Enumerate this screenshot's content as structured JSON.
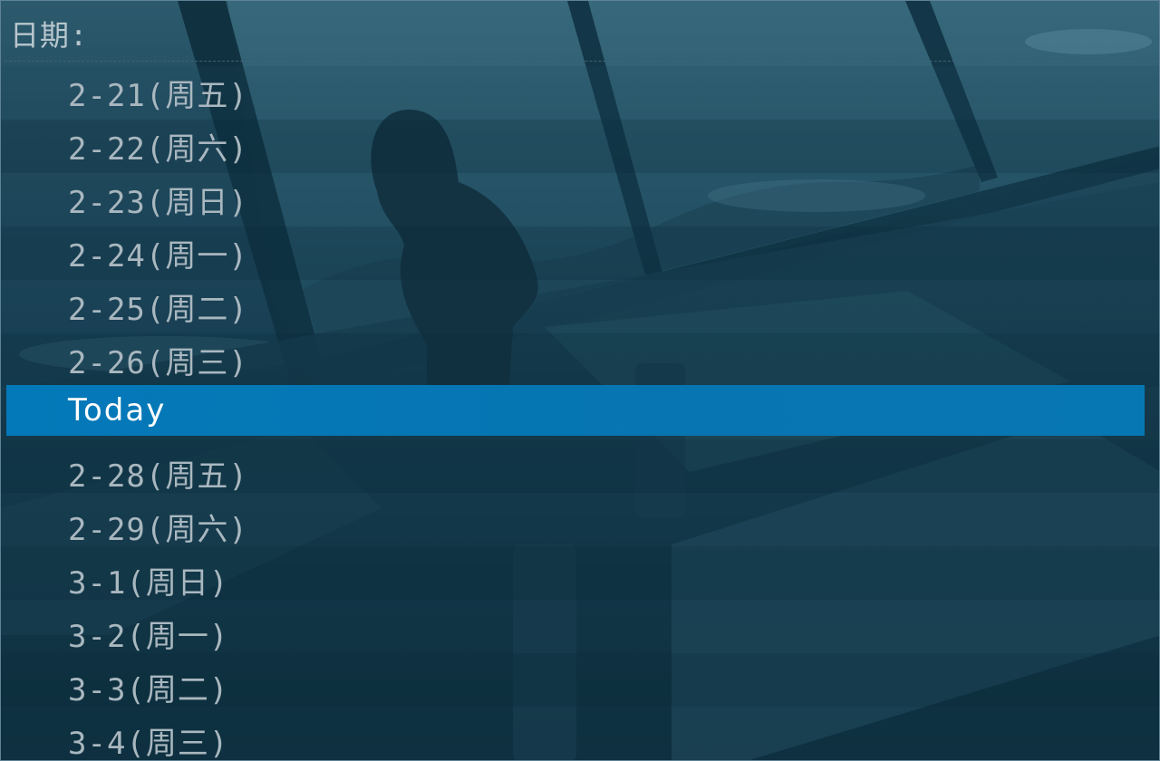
{
  "menu": {
    "prompt": "日期:",
    "items": [
      {
        "label": "2-21(周五)",
        "selected": false
      },
      {
        "label": "2-22(周六)",
        "selected": false
      },
      {
        "label": "2-23(周日)",
        "selected": false
      },
      {
        "label": "2-24(周一)",
        "selected": false
      },
      {
        "label": "2-25(周二)",
        "selected": false
      },
      {
        "label": "2-26(周三)",
        "selected": false
      },
      {
        "label": "Today",
        "selected": true
      },
      {
        "label": "2-28(周五)",
        "selected": false
      },
      {
        "label": "2-29(周六)",
        "selected": false
      },
      {
        "label": "3-1(周日)",
        "selected": false
      },
      {
        "label": "3-2(周一)",
        "selected": false
      },
      {
        "label": "3-3(周二)",
        "selected": false
      },
      {
        "label": "3-4(周三)",
        "selected": false
      }
    ]
  },
  "colors": {
    "selection": "#0479b9",
    "text": "#a9b7bf",
    "selected_text": "#ffffff",
    "background": "#12384b"
  }
}
